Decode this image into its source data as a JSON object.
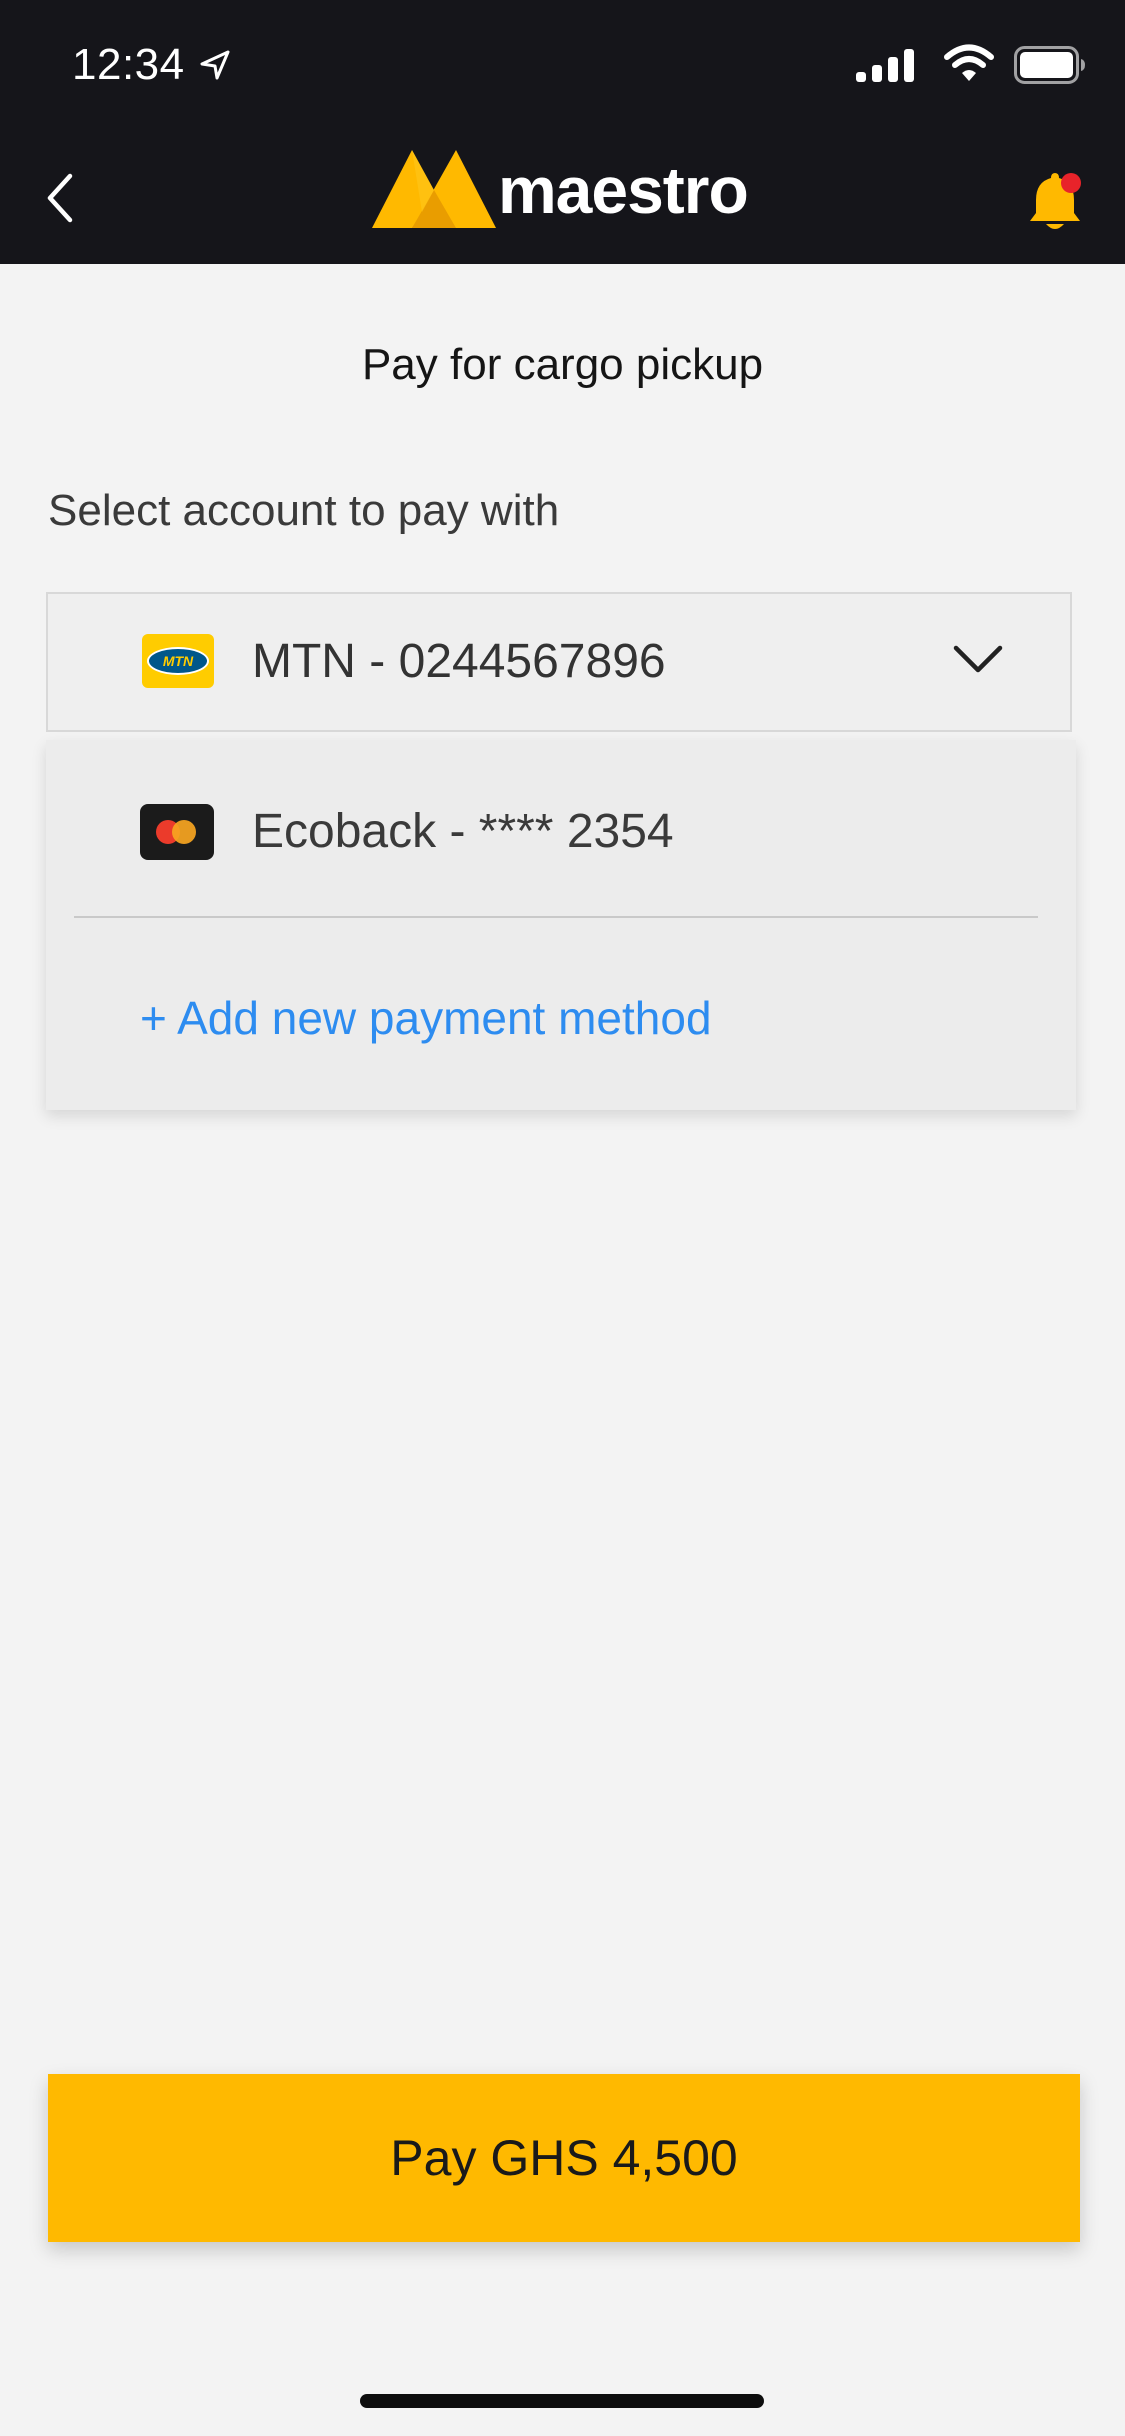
{
  "status_bar": {
    "time": "12:34",
    "icons": [
      "location-arrow-icon",
      "cellular-signal-icon",
      "wifi-icon",
      "battery-icon"
    ]
  },
  "header": {
    "back_icon": "chevron-left-icon",
    "brand_name": "maestro",
    "notification_icon": "bell-icon",
    "notification_badge_color": "#e8232a"
  },
  "page": {
    "title": "Pay for cargo pickup",
    "section_label": "Select account to pay with"
  },
  "account_select": {
    "selected": {
      "provider_logo": "MTN",
      "label": "MTN - 0244567896"
    },
    "expand_icon": "chevron-down-icon",
    "options": [
      {
        "logo_icon": "mastercard-icon",
        "label": "Ecoback - **** 2354"
      }
    ],
    "add_new_label": "+ Add new payment method"
  },
  "pay_button": {
    "label": "Pay GHS 4,500"
  },
  "colors": {
    "header_bg": "#15151a",
    "accent_yellow": "#ffb900",
    "link_blue": "#2d8cf0",
    "page_bg": "#f3f3f3"
  }
}
